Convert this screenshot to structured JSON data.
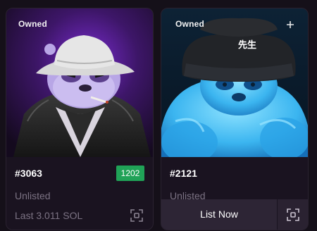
{
  "cards": [
    {
      "owned_label": "Owned",
      "token_id": "#3063",
      "rank": "1202",
      "status": "Unlisted",
      "last_price": "Last 3.011 SOL",
      "colors": {
        "background": "#3a1560",
        "rank_badge": "#20a257"
      },
      "icons": [
        "expand-scan-icon"
      ]
    },
    {
      "owned_label": "Owned",
      "token_id": "#2121",
      "status": "Unlisted",
      "hat_text": "先生",
      "action_label": "List Now",
      "colors": {
        "background": "#0a1c2e",
        "panda": "#39b8f0"
      },
      "icons": [
        "plus-icon",
        "expand-scan-icon"
      ]
    }
  ]
}
